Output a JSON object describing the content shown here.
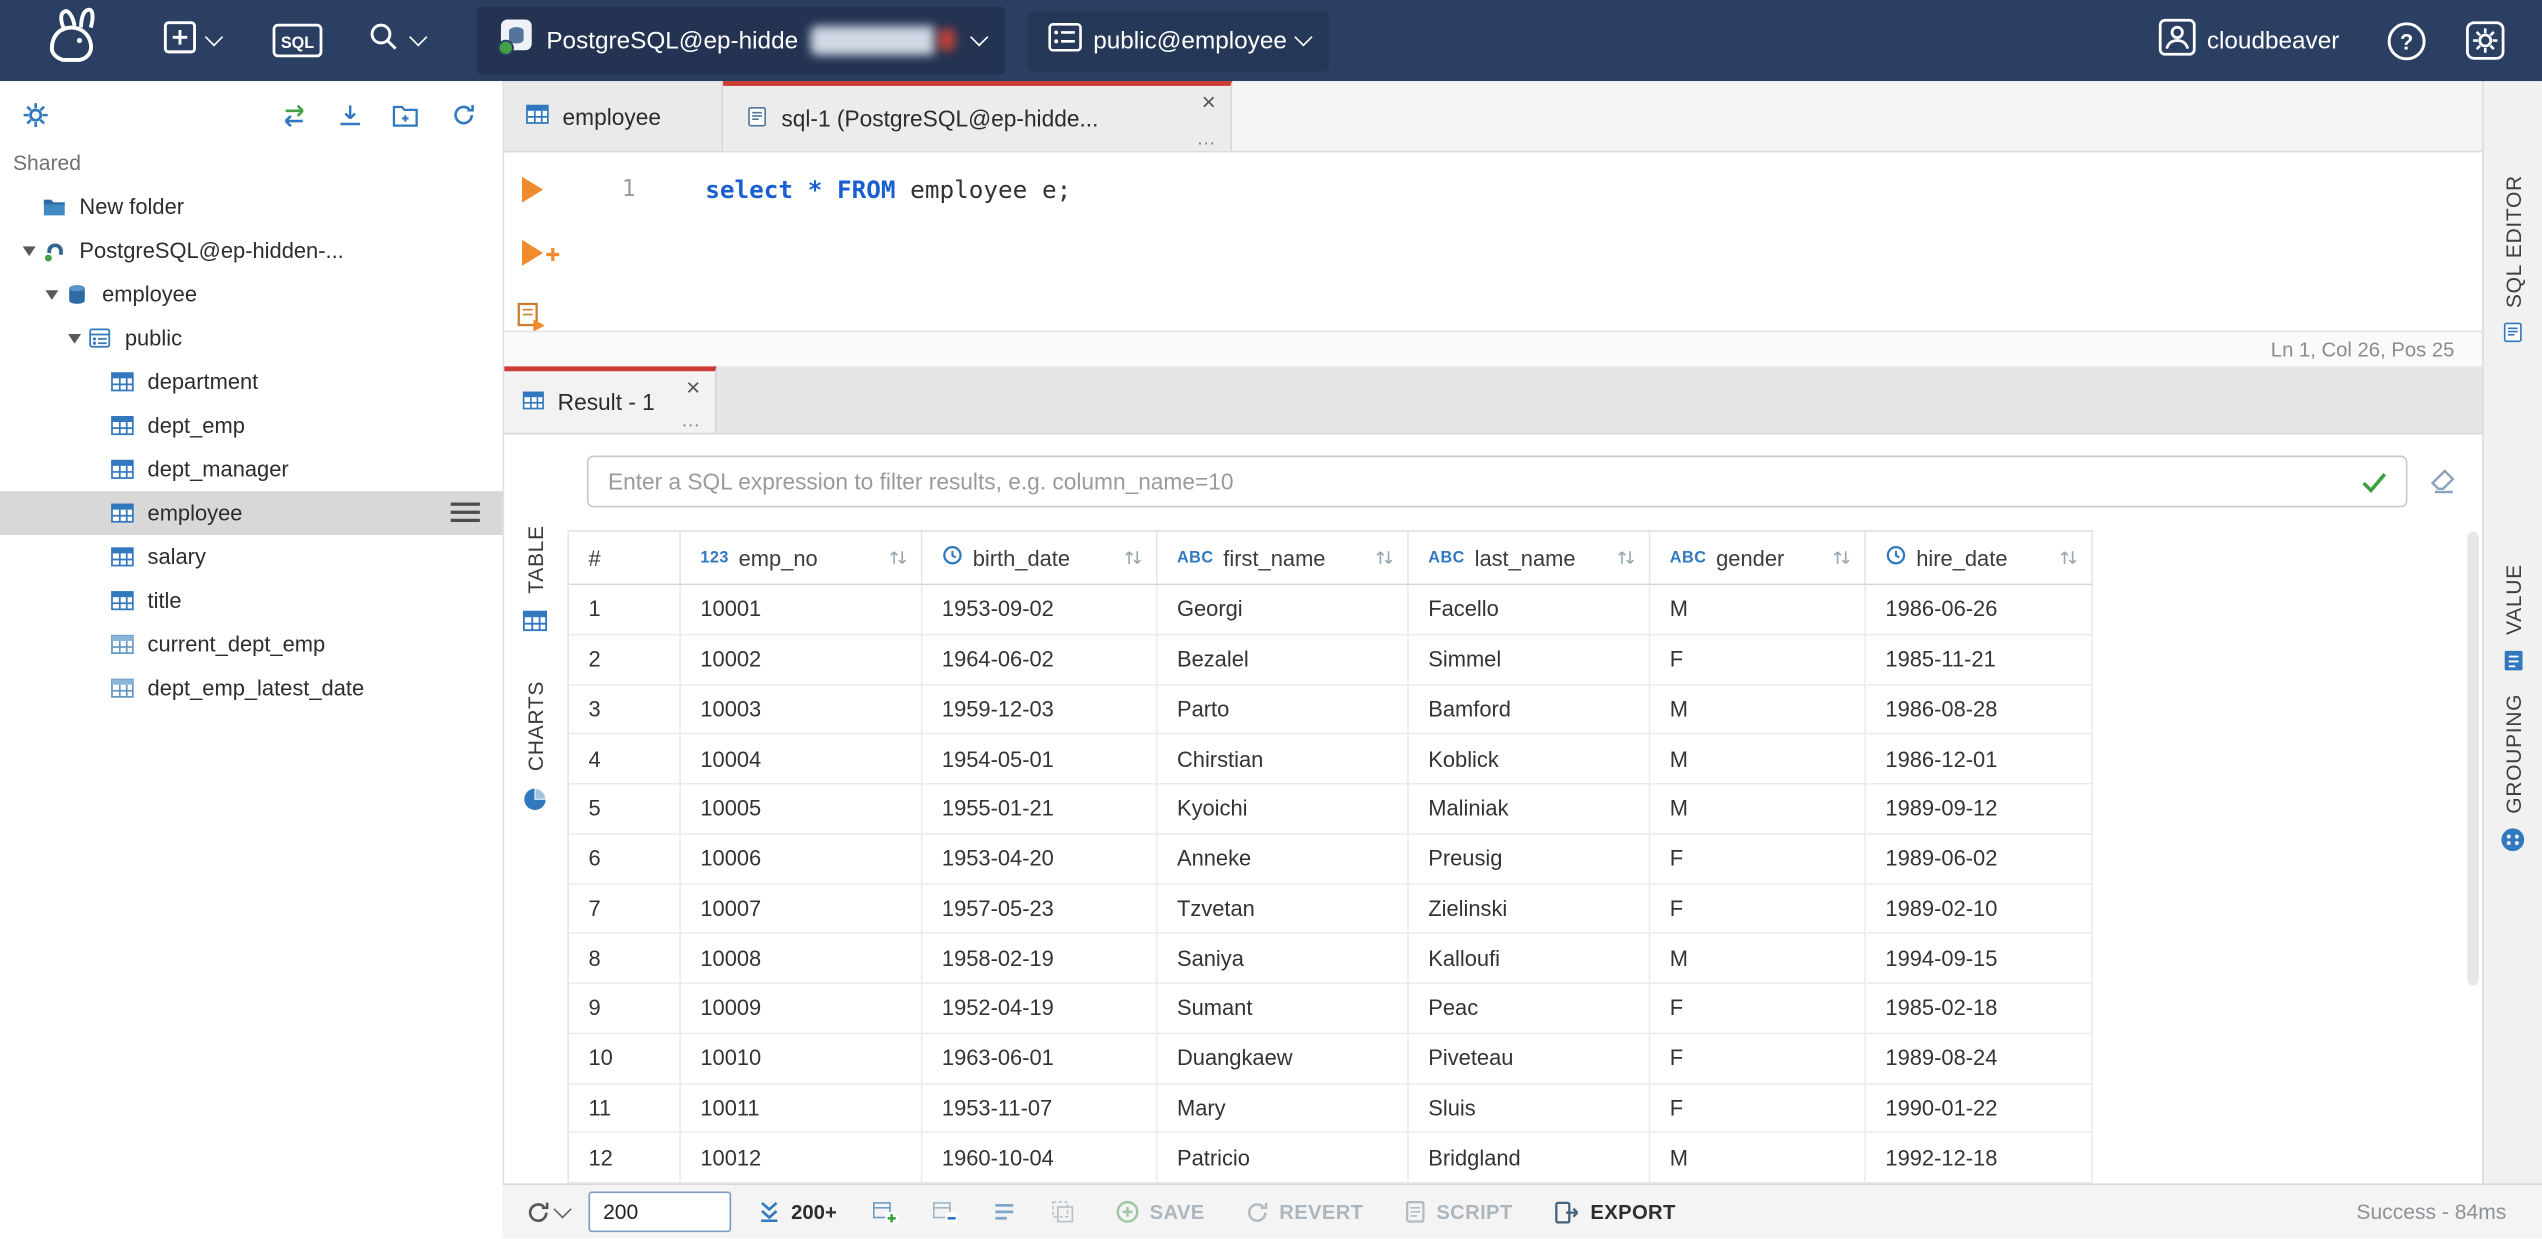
{
  "colors": {
    "accent": "#3178be",
    "topbar": "#2b3f63",
    "marker": "#cf3e36",
    "keyword": "#1a5fd0"
  },
  "glyphs": {
    "close": "×",
    "more": "…",
    "help": "?"
  },
  "topbar": {
    "sql_badge": "SQL",
    "connection_label": "PostgreSQL@ep-hidde",
    "schema_label": "public@employee",
    "user_label": "cloudbeaver"
  },
  "sidebar": {
    "section_label": "Shared",
    "tree": [
      {
        "label": "New folder",
        "icon": "folder",
        "indent": 0
      },
      {
        "label": "PostgreSQL@ep-hidden-...",
        "icon": "postgres",
        "indent": 0,
        "expanded": true
      },
      {
        "label": "employee",
        "icon": "database",
        "indent": 1,
        "expanded": true
      },
      {
        "label": "public",
        "icon": "schema",
        "indent": 2,
        "expanded": true
      },
      {
        "label": "department",
        "icon": "table",
        "indent": 3
      },
      {
        "label": "dept_emp",
        "icon": "table",
        "indent": 3
      },
      {
        "label": "dept_manager",
        "icon": "table",
        "indent": 3
      },
      {
        "label": "employee",
        "icon": "table",
        "indent": 3,
        "selected": true
      },
      {
        "label": "salary",
        "icon": "table",
        "indent": 3
      },
      {
        "label": "title",
        "icon": "table",
        "indent": 3
      },
      {
        "label": "current_dept_emp",
        "icon": "view",
        "indent": 3
      },
      {
        "label": "dept_emp_latest_date",
        "icon": "view",
        "indent": 3
      }
    ]
  },
  "editor": {
    "tabs": [
      {
        "label": "employee",
        "icon": "table",
        "active": false
      },
      {
        "label": "sql-1 (PostgreSQL@ep-hidde...",
        "icon": "script",
        "active": true
      }
    ],
    "line_number": "1",
    "code": [
      {
        "text": "select",
        "type": "kw"
      },
      {
        "text": " ",
        "type": "plain"
      },
      {
        "text": "*",
        "type": "kw"
      },
      {
        "text": " ",
        "type": "plain"
      },
      {
        "text": "FROM",
        "type": "kw"
      },
      {
        "text": " employee e;",
        "type": "plain"
      }
    ],
    "status": "Ln 1, Col 26, Pos 25",
    "side_tab": "SQL EDITOR"
  },
  "results": {
    "tab_label": "Result - 1",
    "filter_placeholder": "Enter a SQL expression to filter results, e.g. column_name=10",
    "left_tabs": [
      "TABLE",
      "CHARTS"
    ],
    "right_tabs": [
      "VALUE",
      "GROUPING"
    ]
  },
  "grid": {
    "type_badges": {
      "number": "123",
      "string": "ABC"
    },
    "columns": [
      {
        "label": "#",
        "type": "rownum"
      },
      {
        "label": "emp_no",
        "type": "number"
      },
      {
        "label": "birth_date",
        "type": "datetime"
      },
      {
        "label": "first_name",
        "type": "string"
      },
      {
        "label": "last_name",
        "type": "string"
      },
      {
        "label": "gender",
        "type": "string"
      },
      {
        "label": "hire_date",
        "type": "datetime"
      }
    ],
    "rows": [
      [
        "1",
        "10001",
        "1953-09-02",
        "Georgi",
        "Facello",
        "M",
        "1986-06-26"
      ],
      [
        "2",
        "10002",
        "1964-06-02",
        "Bezalel",
        "Simmel",
        "F",
        "1985-11-21"
      ],
      [
        "3",
        "10003",
        "1959-12-03",
        "Parto",
        "Bamford",
        "M",
        "1986-08-28"
      ],
      [
        "4",
        "10004",
        "1954-05-01",
        "Chirstian",
        "Koblick",
        "M",
        "1986-12-01"
      ],
      [
        "5",
        "10005",
        "1955-01-21",
        "Kyoichi",
        "Maliniak",
        "M",
        "1989-09-12"
      ],
      [
        "6",
        "10006",
        "1953-04-20",
        "Anneke",
        "Preusig",
        "F",
        "1989-06-02"
      ],
      [
        "7",
        "10007",
        "1957-05-23",
        "Tzvetan",
        "Zielinski",
        "F",
        "1989-02-10"
      ],
      [
        "8",
        "10008",
        "1958-02-19",
        "Saniya",
        "Kalloufi",
        "M",
        "1994-09-15"
      ],
      [
        "9",
        "10009",
        "1952-04-19",
        "Sumant",
        "Peac",
        "F",
        "1985-02-18"
      ],
      [
        "10",
        "10010",
        "1963-06-01",
        "Duangkaew",
        "Piveteau",
        "F",
        "1989-08-24"
      ],
      [
        "11",
        "10011",
        "1953-11-07",
        "Mary",
        "Sluis",
        "F",
        "1990-01-22"
      ],
      [
        "12",
        "10012",
        "1960-10-04",
        "Patricio",
        "Bridgland",
        "M",
        "1992-12-18"
      ]
    ]
  },
  "toolbar": {
    "row_limit": "200",
    "fetch_label": "200+",
    "save_label": "SAVE",
    "revert_label": "REVERT",
    "script_label": "SCRIPT",
    "export_label": "EXPORT",
    "status": "Success - 84ms"
  }
}
